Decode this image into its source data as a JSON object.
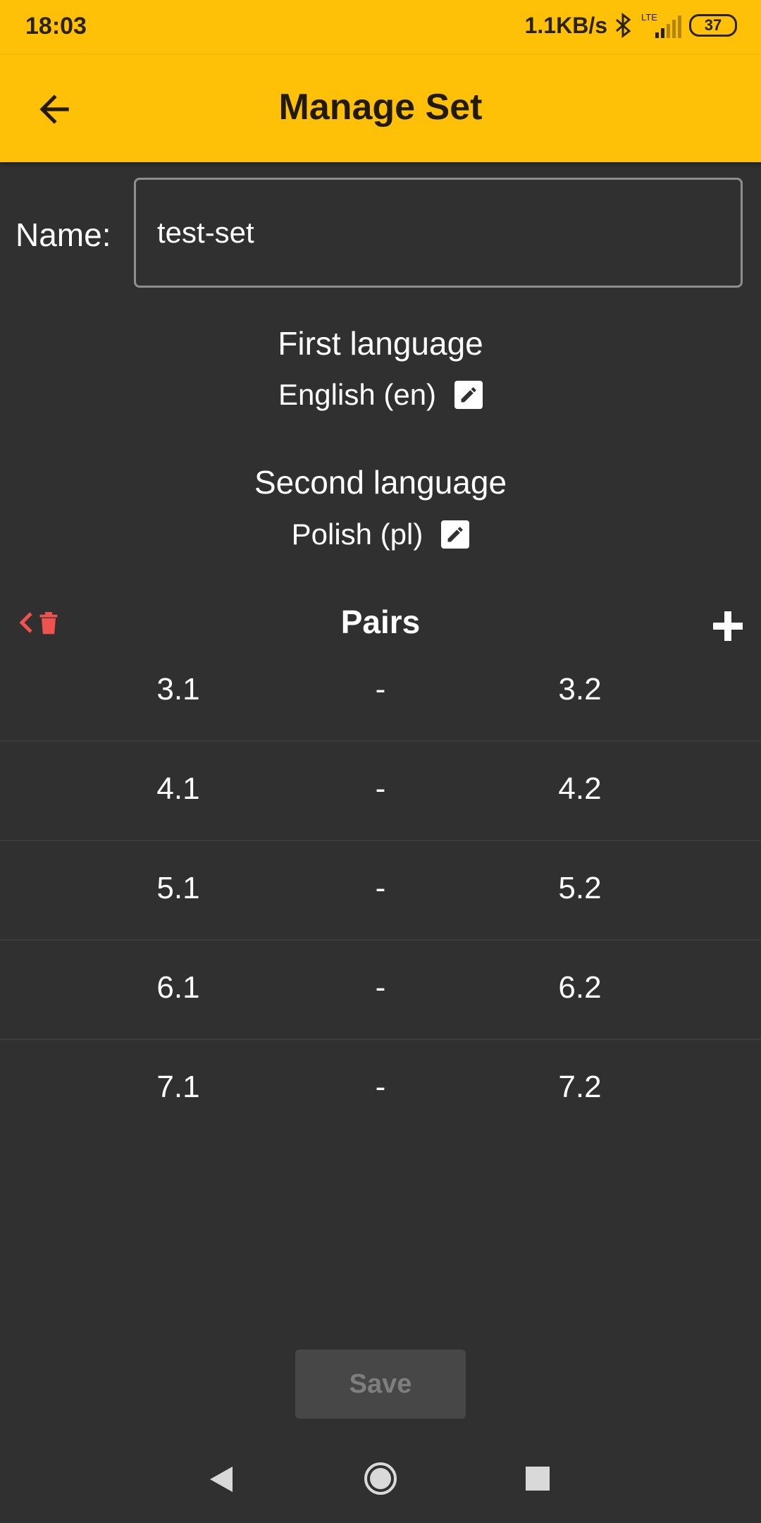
{
  "status_bar": {
    "time": "18:03",
    "network_speed": "1.1KB/s",
    "network_type": "LTE",
    "battery": "37"
  },
  "app_bar": {
    "title": "Manage Set",
    "back_icon": "arrow-left-icon"
  },
  "form": {
    "name_label": "Name:",
    "name_value": "test-set"
  },
  "languages": {
    "first": {
      "heading": "First language",
      "value": "English (en)",
      "edit_icon": "pencil-icon"
    },
    "second": {
      "heading": "Second language",
      "value": "Polish (pl)",
      "edit_icon": "pencil-icon"
    }
  },
  "pairs": {
    "title": "Pairs",
    "delete_icon": "trash-icon",
    "add_icon": "plus-icon",
    "items": [
      {
        "first": "3.1",
        "separator": "-",
        "second": "3.2"
      },
      {
        "first": "4.1",
        "separator": "-",
        "second": "4.2"
      },
      {
        "first": "5.1",
        "separator": "-",
        "second": "5.2"
      },
      {
        "first": "6.1",
        "separator": "-",
        "second": "6.2"
      },
      {
        "first": "7.1",
        "separator": "-",
        "second": "7.2"
      }
    ]
  },
  "actions": {
    "save_label": "Save"
  },
  "colors": {
    "accent": "#FFC107",
    "background": "#303030",
    "danger": "#EF5350"
  }
}
